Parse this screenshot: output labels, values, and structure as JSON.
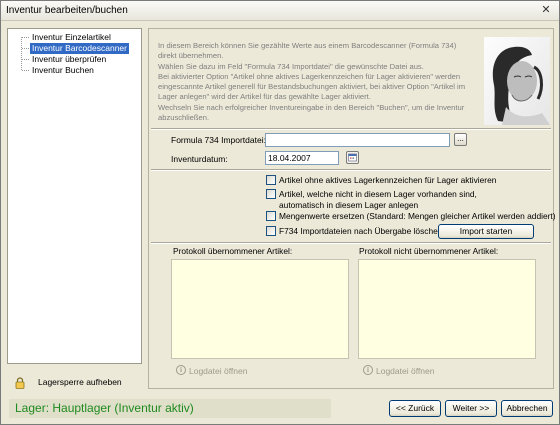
{
  "window": {
    "title": "Inventur bearbeiten/buchen",
    "close_glyph": "✕"
  },
  "nav": {
    "items": [
      {
        "label": "Inventur Einzelartikel",
        "selected": false
      },
      {
        "label": "Inventur Barcodescanner",
        "selected": true
      },
      {
        "label": "Inventur überprüfen",
        "selected": false
      },
      {
        "label": "Inventur Buchen",
        "selected": false
      }
    ]
  },
  "lock": {
    "icon": "lock-icon",
    "label": "Lagersperre aufheben"
  },
  "info": {
    "lines": [
      "In diesem Bereich können Sie gezählte Werte aus einem Barcodescanner (Formula 734)",
      "direkt übernehmen.",
      "Wählen Sie dazu im Feld \"Formula 734 Importdatei\" die gewünschte Datei aus.",
      "Bei aktivierter Option \"Artikel ohne aktives Lagerkennzeichen für Lager aktivieren\" werden",
      "eingescannte Artikel generell für Bestandsbuchungen aktiviert, bei aktiver Option \"Artikel im",
      "Lager anlegen\" wird der Artikel für das gewählte Lager aktiviert.",
      "Wechseln Sie nach erfolgreicher Inventureingabe in den Bereich \"Buchen\", um die Inventur",
      "abzuschließen."
    ]
  },
  "form": {
    "import_label": "Formula 734 Importdatei:",
    "import_value": "",
    "browse_label": "...",
    "date_label": "Inventurdatum:",
    "date_value": "18.04.2007",
    "calendar_icon": "calendar-icon"
  },
  "options": {
    "activate_articles": {
      "label": "Artikel ohne aktives Lagerkennzeichen für Lager aktivieren",
      "checked": false
    },
    "create_articles": {
      "label_line1": "Artikel, welche nicht in diesem Lager vorhanden sind,",
      "label_line2": "automatisch in diesem Lager anlegen",
      "checked": false
    },
    "replace_quantities": {
      "label": "Mengenwerte ersetzen (Standard: Mengen gleicher Artikel werden addiert)",
      "checked": false
    },
    "delete_after_import": {
      "label": "F734 Importdateien nach Übergabe löschen",
      "checked": false
    },
    "import_button": "Import starten"
  },
  "logs": {
    "accepted_label": "Protokoll übernommener Artikel:",
    "rejected_label": "Protokoll nicht übernommener Artikel:",
    "open_log_label": "Logdatei öffnen",
    "info_glyph": "i"
  },
  "status": {
    "text": "Lager: Hauptlager (Inventur aktiv)",
    "color": "#1f8a1f"
  },
  "footer": {
    "back_label": "<< Zurück",
    "next_label": "Weiter >>",
    "cancel_label": "Abbrechen"
  },
  "colors": {
    "selection": "#316ac5",
    "log_background": "#ffffe1",
    "window_background": "#ece9d8"
  }
}
